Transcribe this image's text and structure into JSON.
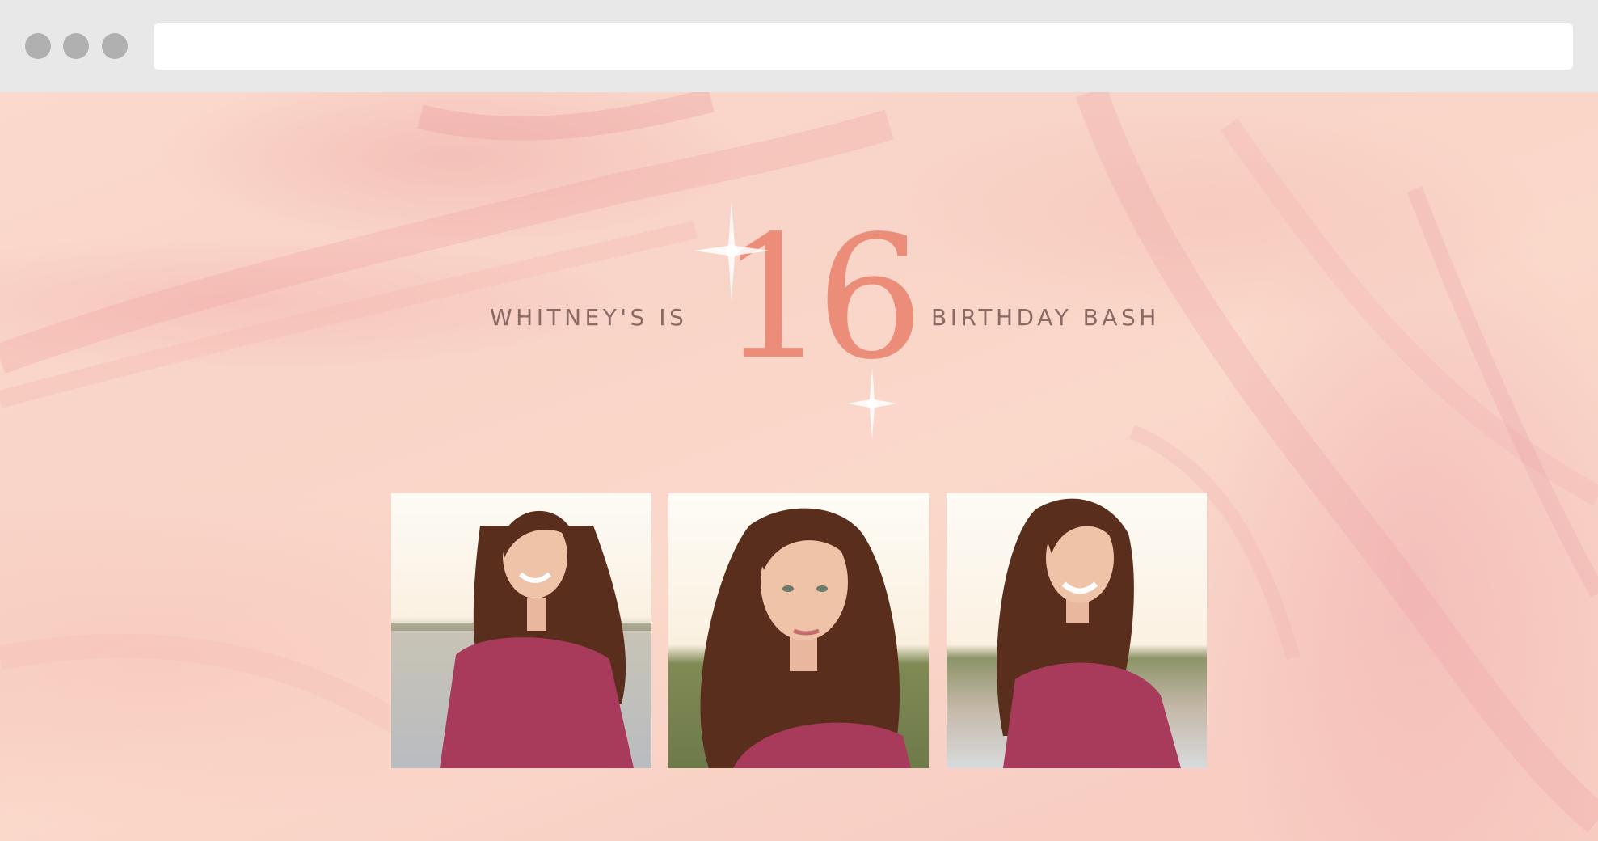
{
  "browser": {
    "url": "",
    "window_controls": [
      "close",
      "minimize",
      "maximize"
    ]
  },
  "headline": {
    "left_text": "WHITNEY'S IS",
    "number": "16",
    "right_text": "BIRTHDAY BASH"
  },
  "photos": [
    {
      "icon": "portrait-photo-smiling"
    },
    {
      "icon": "portrait-photo-looking-at-camera"
    },
    {
      "icon": "portrait-photo-laughing"
    }
  ],
  "colors": {
    "background": "#f9d4c8",
    "number": "#ec8d7a",
    "text": "#8a6a62",
    "dress": "#a83a5c",
    "hair": "#5a2e1c",
    "chrome": "#e8e8e8"
  }
}
